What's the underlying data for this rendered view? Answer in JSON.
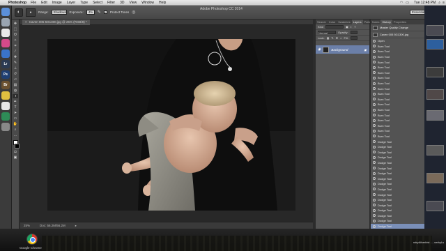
{
  "menubar": {
    "app_name": "Photoshop",
    "items": [
      "File",
      "Edit",
      "Image",
      "Layer",
      "Type",
      "Select",
      "Filter",
      "3D",
      "View",
      "Window",
      "Help"
    ],
    "clock": "Tue 12:48 PM"
  },
  "window_title": "Adobe Photoshop CC 2014",
  "options": {
    "range_label": "Range:",
    "range_value": "Shadows",
    "exposure_label": "Exposure:",
    "exposure_value": "4%",
    "protect_tones_label": "Protect Tones",
    "workspace": "Essentials"
  },
  "document": {
    "tab_title": "Caven 005 5G1300.jpg @ 25% (RGB/8) *",
    "status_zoom": "25%",
    "status_doc": "Doc: 56.2M/56.2M"
  },
  "layers_panel": {
    "tabs": [
      "Search",
      "Color",
      "Swatches",
      "Layers",
      "Paths",
      "Channels"
    ],
    "active_tab": "Layers",
    "kind_label": "Kind",
    "blend_mode": "Normal",
    "opacity_label": "Opacity:",
    "lock_label": "Lock:",
    "fill_label": "Fill:",
    "layer_name": "Background"
  },
  "history_panel": {
    "tabs": [
      "Notes",
      "History",
      "Properties"
    ],
    "active_tab": "History",
    "snapshots": [
      "Master Quality Change",
      "Caven 005 5G1300.jpg"
    ],
    "open_label": "Open",
    "items": [
      "Open",
      "Burn Tool",
      "Burn Tool",
      "Burn Tool",
      "Burn Tool",
      "Burn Tool",
      "Burn Tool",
      "Burn Tool",
      "Burn Tool",
      "Burn Tool",
      "Burn Tool",
      "Burn Tool",
      "Burn Tool",
      "Burn Tool",
      "Burn Tool",
      "Burn Tool",
      "Burn Tool",
      "Burn Tool",
      "Burn Tool",
      "Dodge Tool",
      "Dodge Tool",
      "Dodge Tool",
      "Dodge Tool",
      "Dodge Tool",
      "Dodge Tool",
      "Dodge Tool",
      "Dodge Tool",
      "Dodge Tool",
      "Dodge Tool",
      "Dodge Tool",
      "Dodge Tool",
      "Dodge Tool",
      "Dodge Tool",
      "Dodge Tool",
      "Dodge Tool",
      "Dodge Tool"
    ],
    "selected_index": 35
  },
  "dock_icons": [
    "finder-icon",
    "launchpad-icon",
    "chrome-icon",
    "itunes-icon",
    "mail-icon",
    "lightroom-icon",
    "photoshop-icon",
    "bridge-icon",
    "notes-icon",
    "calendar-icon",
    "evernote-icon",
    "trash-icon"
  ],
  "dock_labels": [
    "",
    "",
    "",
    "",
    "",
    "Lr",
    "Ps",
    "Br",
    "",
    "",
    "",
    ""
  ],
  "taskbar": {
    "app_label": "Google Chrome",
    "downloads_label": "ndryAtherbist ... .verbyLs"
  }
}
